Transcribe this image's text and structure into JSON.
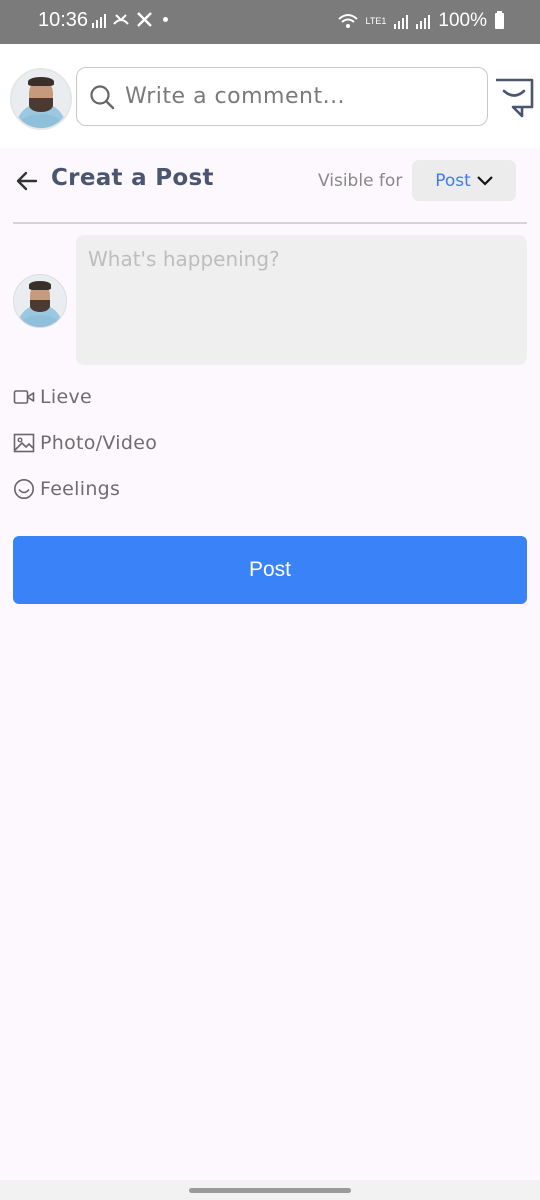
{
  "status_bar": {
    "time": "10:36",
    "battery": "100%",
    "net_label": "LTE1"
  },
  "comment_bar": {
    "search_placeholder": "Write a comment..."
  },
  "header": {
    "title": "Creat a Post",
    "visible_for_label": "Visible for",
    "visibility_value": "Post"
  },
  "composer": {
    "placeholder": "What's happening?"
  },
  "options": [
    {
      "label": "Lieve",
      "icon": "video-camera-icon"
    },
    {
      "label": "Photo/Video",
      "icon": "image-icon"
    },
    {
      "label": "Feelings",
      "icon": "smiley-icon"
    }
  ],
  "post_button": {
    "label": "Post"
  },
  "colors": {
    "accent": "#3a82f7",
    "title": "#4a5670",
    "background": "#fdf8fd"
  }
}
